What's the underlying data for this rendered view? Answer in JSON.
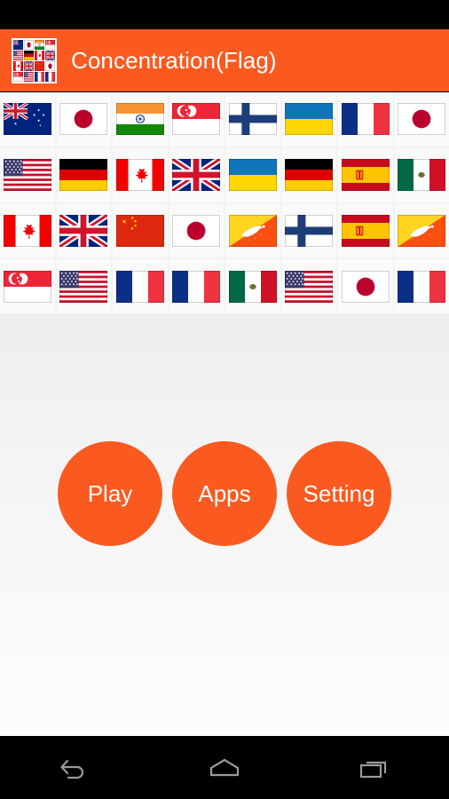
{
  "app": {
    "title": "Concentration(Flag)",
    "icon_name": "flag-grid-app-icon",
    "accent_color": "#FA5A20",
    "title_color": "#FFFFFF"
  },
  "status_bar": {
    "background": "#000000"
  },
  "grid": {
    "columns": 8,
    "rows": 4,
    "cells": [
      {
        "country": "Australia",
        "code": "au"
      },
      {
        "country": "Japan",
        "code": "jp"
      },
      {
        "country": "India",
        "code": "in"
      },
      {
        "country": "Singapore",
        "code": "sg"
      },
      {
        "country": "Finland",
        "code": "fi"
      },
      {
        "country": "Ukraine",
        "code": "ua"
      },
      {
        "country": "France",
        "code": "fr"
      },
      {
        "country": "Japan",
        "code": "jp"
      },
      {
        "country": "United States",
        "code": "us"
      },
      {
        "country": "Germany",
        "code": "de"
      },
      {
        "country": "Canada",
        "code": "ca"
      },
      {
        "country": "United Kingdom",
        "code": "gb"
      },
      {
        "country": "Ukraine",
        "code": "ua"
      },
      {
        "country": "Germany",
        "code": "de"
      },
      {
        "country": "Spain",
        "code": "es"
      },
      {
        "country": "Mexico",
        "code": "mx"
      },
      {
        "country": "Canada",
        "code": "ca"
      },
      {
        "country": "United Kingdom",
        "code": "gb"
      },
      {
        "country": "China",
        "code": "cn"
      },
      {
        "country": "Japan",
        "code": "jp"
      },
      {
        "country": "Bhutan",
        "code": "bt"
      },
      {
        "country": "Finland",
        "code": "fi"
      },
      {
        "country": "Spain",
        "code": "es"
      },
      {
        "country": "Bhutan",
        "code": "bt"
      },
      {
        "country": "Singapore",
        "code": "sg"
      },
      {
        "country": "United States",
        "code": "us"
      },
      {
        "country": "France",
        "code": "fr"
      },
      {
        "country": "France",
        "code": "fr"
      },
      {
        "country": "Mexico",
        "code": "mx"
      },
      {
        "country": "United States",
        "code": "us"
      },
      {
        "country": "Japan",
        "code": "jp"
      },
      {
        "country": "France",
        "code": "fr"
      }
    ]
  },
  "app_icon_cells": [
    {
      "code": "au"
    },
    {
      "code": "jp"
    },
    {
      "code": "in"
    },
    {
      "code": "sg"
    },
    {
      "code": "us"
    },
    {
      "code": "de"
    },
    {
      "code": "ca"
    },
    {
      "code": "gb"
    },
    {
      "code": "ca"
    },
    {
      "code": "gb"
    },
    {
      "code": "cn"
    },
    {
      "code": "jp"
    },
    {
      "code": "sg"
    },
    {
      "code": "us"
    },
    {
      "code": "fr"
    },
    {
      "code": "fr"
    }
  ],
  "buttons": [
    {
      "label": "Play",
      "name": "play-button"
    },
    {
      "label": "Apps",
      "name": "apps-button"
    },
    {
      "label": "Setting",
      "name": "setting-button"
    }
  ],
  "nav_bar": {
    "background": "#000000",
    "items": [
      {
        "label": "Back",
        "icon": "back-arrow-icon"
      },
      {
        "label": "Home",
        "icon": "home-icon"
      },
      {
        "label": "Recents",
        "icon": "recents-icon"
      }
    ]
  }
}
